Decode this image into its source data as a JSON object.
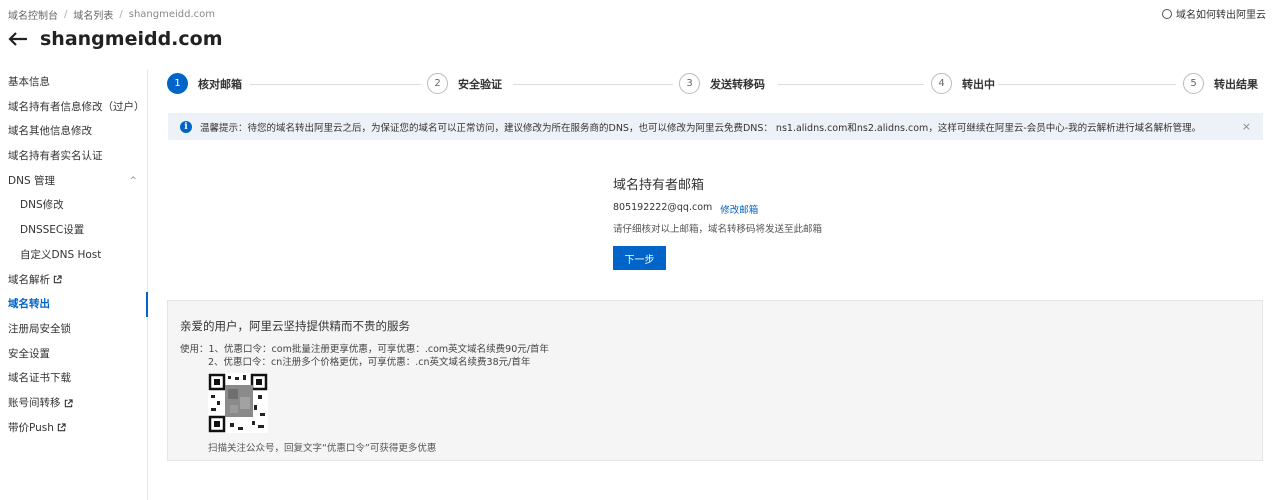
{
  "breadcrumb": {
    "items": [
      "域名控制台",
      "域名列表",
      "shangmeidd.com"
    ]
  },
  "topright": {
    "text": "域名如何转出阿里云"
  },
  "header": {
    "title": "shangmeidd.com"
  },
  "sidebar": {
    "items": [
      {
        "label": "基本信息"
      },
      {
        "label": "域名持有者信息修改（过户）"
      },
      {
        "label": "域名其他信息修改"
      },
      {
        "label": "域名持有者实名认证"
      },
      {
        "label": "DNS 管理"
      },
      {
        "label": "DNS修改"
      },
      {
        "label": "DNSSEC设置"
      },
      {
        "label": "自定义DNS Host"
      },
      {
        "label": "域名解析"
      },
      {
        "label": "域名转出"
      },
      {
        "label": "注册局安全锁"
      },
      {
        "label": "安全设置"
      },
      {
        "label": "域名证书下载"
      },
      {
        "label": "账号间转移"
      },
      {
        "label": "带价Push"
      }
    ]
  },
  "steps": [
    {
      "num": "1",
      "label": "核对邮箱"
    },
    {
      "num": "2",
      "label": "安全验证"
    },
    {
      "num": "3",
      "label": "发送转移码"
    },
    {
      "num": "4",
      "label": "转出中"
    },
    {
      "num": "5",
      "label": "转出结果"
    }
  ],
  "notice": {
    "text": "温馨提示：待您的域名转出阿里云之后，为保证您的域名可以正常访问，建议修改为所在服务商的DNS，也可以修改为阿里云免费DNS： ns1.alidns.com和ns2.alidns.com，这样可继续在阿里云-会员中心-我的云解析进行域名解析管理。",
    "close": "×"
  },
  "email": {
    "heading": "域名持有者邮箱",
    "address": "805192222@qq.com",
    "change_link": "修改邮箱",
    "hint": "请仔细核对以上邮箱，域名转移码将发送至此邮箱"
  },
  "next_button": "下一步",
  "promo": {
    "title": "亲爱的用户，阿里云坚持提供精而不贵的服务",
    "line1": "使用：1、优惠口令：com批量注册更享优惠，可享优惠：.com英文域名续费90元/首年",
    "line2": "2、优惠口令：cn注册多个价格更优，可享优惠：.cn英文域名续费38元/首年",
    "footer": "扫描关注公众号，回复文字“优惠口令”可获得更多优惠"
  },
  "colors": {
    "accent": "#0064c8",
    "notice_bg": "#edf2f8",
    "promo_bg": "#f5f5f5"
  }
}
